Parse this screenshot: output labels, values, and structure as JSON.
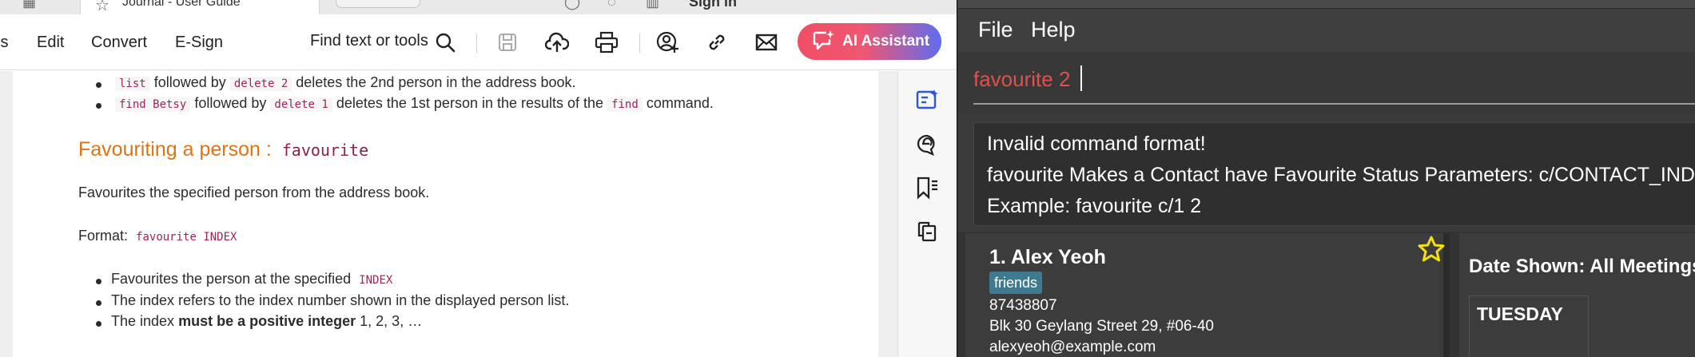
{
  "pdf_viewer": {
    "tab_title_fragment": "Journal - User Guide",
    "sign_in": "Sign in",
    "menu": [
      "Tools",
      "Edit",
      "Convert",
      "E-Sign"
    ],
    "find_tools": "Find text or tools",
    "ai_assistant": "AI Assistant",
    "toolbar_icons": [
      "search-icon",
      "save-icon",
      "upload-cloud-icon",
      "print-icon",
      "share-user-icon",
      "link-icon",
      "mail-icon"
    ],
    "rail_icons": [
      "edit-text-icon",
      "comment-icon",
      "bookmark-list-icon",
      "copy-pages-icon"
    ],
    "document": {
      "bullet1": {
        "code1": "list",
        "text1": "followed by",
        "code2": "delete 2",
        "text2": "deletes the 2nd person in the address book."
      },
      "bullet2": {
        "code1": "find Betsy",
        "text1": "followed by",
        "code2": "delete 1",
        "text2": "deletes the 1st person in the results of the",
        "code3": "find",
        "text3": "command."
      },
      "heading_text": "Favouriting a person :",
      "heading_code": "favourite",
      "description": "Favourites the specified person from the address book.",
      "format_label": "Format:",
      "format_code": "favourite INDEX",
      "point1_text": "Favourites the person at the specified",
      "point1_code": "INDEX",
      "point2_text": "The index refers to the index number shown in the displayed person list.",
      "point3_prefix": "The index",
      "point3_bold": "must be a positive integer",
      "point3_suffix": "1, 2, 3, …"
    }
  },
  "app": {
    "menu": [
      "File",
      "Help"
    ],
    "command_input": "favourite 2",
    "result": {
      "line1": "Invalid command format!",
      "line2": "favourite Makes a Contact have Favourite Status Parameters: c/CONTACT_INDEXES",
      "line3": "Example: favourite c/1 2"
    },
    "person": {
      "name": "1. Alex Yeoh",
      "tag": "friends",
      "phone": "87438807",
      "address": "Blk 30 Geylang Street 29, #06-40",
      "email": "alexyeoh@example.com",
      "favourite": true
    },
    "meetings": {
      "date_shown": "Date Shown: All Meetings",
      "day": "TUESDAY"
    },
    "colors": {
      "background": "#3b3b3b",
      "command_text": "#e0504c",
      "tag": "#3e7b91",
      "favourite_star": "#f4e012"
    }
  }
}
